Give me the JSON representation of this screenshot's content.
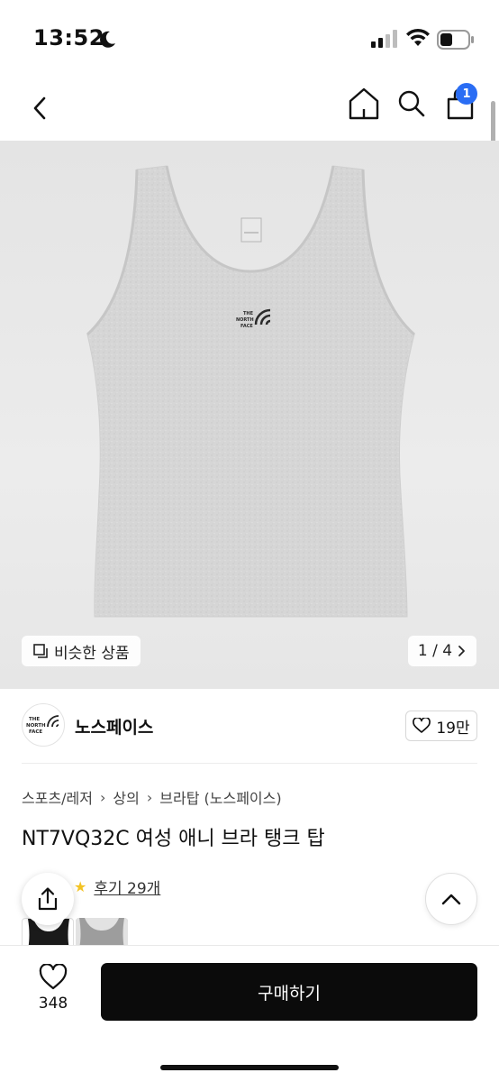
{
  "status": {
    "time": "13:52"
  },
  "nav": {
    "cart_count": "1"
  },
  "product_image": {
    "similar_label": "비슷한 상품",
    "page_indicator": "1 / 4",
    "logo_text": [
      "THE",
      "NORTH",
      "FACE"
    ]
  },
  "brand": {
    "name": "노스페이스",
    "likes": "19만",
    "logo_text": [
      "THE",
      "NORTH",
      "FACE"
    ]
  },
  "breadcrumb": [
    "스포츠/레저",
    "상의",
    "브라탑 (노스페이스)"
  ],
  "product": {
    "title": "NT7VQ32C 여성 애니 브라 탱크 탑",
    "review_label": "후기 29개"
  },
  "bottom": {
    "wish_count": "348",
    "buy_label": "구매하기"
  },
  "colors": {
    "accent": "#2a6df4",
    "buy_button": "#0b0b0b",
    "image_bg": "#e8e8e8",
    "star": "#f3c324"
  }
}
